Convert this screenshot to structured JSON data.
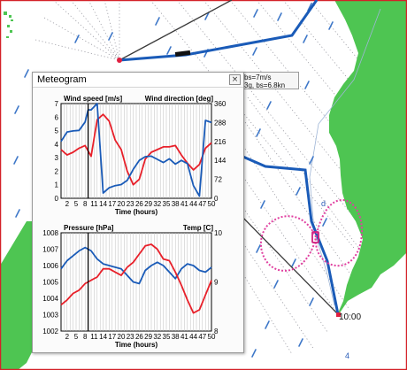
{
  "map": {
    "time_marker": "10:00",
    "waypoint_4": "4",
    "waypoint_d": "d",
    "tooltip_line1": "bs=7m/s",
    "tooltip_line2": "3g, bs=6.8kn"
  },
  "meteogram": {
    "title": "Meteogram",
    "close_symbol": "×",
    "xlabel": "Time (hours)"
  },
  "chart_data": [
    {
      "type": "line",
      "x_ticks": [
        2,
        5,
        8,
        11,
        14,
        17,
        20,
        23,
        26,
        29,
        32,
        35,
        38,
        41,
        44,
        47,
        50
      ],
      "xlabel": "Time (hours)",
      "xlim": [
        0,
        50
      ],
      "left_axis": {
        "label": "Wind speed [m/s]",
        "ylim": [
          0,
          7
        ],
        "ticks": [
          0,
          1,
          2,
          3,
          4,
          5,
          6,
          7
        ]
      },
      "right_axis": {
        "label": "Wind direction [deg]",
        "ylim": [
          0,
          360
        ],
        "ticks": [
          0,
          72,
          144,
          216,
          288,
          360
        ]
      },
      "series": [
        {
          "color": "#e8202a",
          "axis": "left",
          "x": [
            0,
            2,
            4,
            6,
            8,
            10,
            12,
            14,
            16,
            18,
            20,
            22,
            24,
            26,
            28,
            30,
            32,
            34,
            36,
            38,
            40,
            42,
            44,
            46,
            48,
            50
          ],
          "values": [
            3.6,
            3.2,
            3.4,
            3.7,
            3.9,
            3.1,
            5.8,
            6.2,
            5.7,
            4.3,
            3.6,
            2.0,
            1.0,
            1.4,
            2.9,
            3.4,
            3.6,
            3.8,
            3.8,
            3.9,
            3.2,
            2.6,
            2.1,
            2.5,
            3.7,
            4.1
          ]
        },
        {
          "color": "#1a5bb8",
          "axis": "right",
          "x": [
            0,
            2,
            4,
            6,
            8,
            9,
            10,
            12,
            14,
            16,
            18,
            20,
            22,
            24,
            26,
            28,
            30,
            32,
            34,
            36,
            38,
            40,
            42,
            44,
            46,
            48,
            50
          ],
          "values": [
            216,
            252,
            256,
            258,
            290,
            336,
            336,
            360,
            20,
            40,
            48,
            52,
            68,
            110,
            144,
            158,
            160,
            148,
            136,
            150,
            130,
            144,
            132,
            48,
            8,
            296,
            288
          ]
        }
      ],
      "vertical_marker_x": 9
    },
    {
      "type": "line",
      "x_ticks": [
        2,
        5,
        8,
        11,
        14,
        17,
        20,
        23,
        26,
        29,
        32,
        35,
        38,
        41,
        44,
        47,
        50
      ],
      "xlabel": "Time (hours)",
      "xlim": [
        0,
        50
      ],
      "left_axis": {
        "label": "Pressure [hPa]",
        "ylim": [
          1002,
          1008
        ],
        "ticks": [
          1002,
          1003,
          1004,
          1005,
          1006,
          1007,
          1008
        ]
      },
      "right_axis": {
        "label": "Temp [C]",
        "ylim": [
          8,
          10
        ],
        "ticks": [
          8,
          9,
          10
        ]
      },
      "series": [
        {
          "color": "#1a5bb8",
          "axis": "left",
          "x": [
            0,
            2,
            4,
            6,
            8,
            10,
            12,
            14,
            16,
            18,
            20,
            22,
            24,
            26,
            28,
            30,
            32,
            34,
            36,
            38,
            40,
            42,
            44,
            46,
            48,
            50
          ],
          "values": [
            1005.8,
            1006.3,
            1006.6,
            1006.9,
            1007.1,
            1006.9,
            1006.4,
            1006.1,
            1006.0,
            1005.9,
            1005.8,
            1005.4,
            1005.0,
            1004.9,
            1005.7,
            1006.0,
            1006.2,
            1006.0,
            1005.6,
            1005.2,
            1005.8,
            1006.1,
            1006.0,
            1005.7,
            1005.6,
            1005.9
          ]
        },
        {
          "color": "#e8202a",
          "axis": "left",
          "x": [
            0,
            2,
            4,
            6,
            8,
            10,
            12,
            14,
            16,
            18,
            20,
            22,
            24,
            26,
            28,
            30,
            32,
            34,
            36,
            38,
            40,
            42,
            44,
            46,
            48,
            50
          ],
          "values": [
            1003.6,
            1003.9,
            1004.3,
            1004.5,
            1004.9,
            1005.1,
            1005.3,
            1005.8,
            1005.8,
            1005.6,
            1005.4,
            1005.9,
            1006.2,
            1006.7,
            1007.2,
            1007.3,
            1007.0,
            1006.4,
            1006.3,
            1005.6,
            1004.8,
            1003.9,
            1003.1,
            1003.3,
            1004.2,
            1005.1
          ]
        }
      ],
      "vertical_marker_x": 9
    }
  ]
}
